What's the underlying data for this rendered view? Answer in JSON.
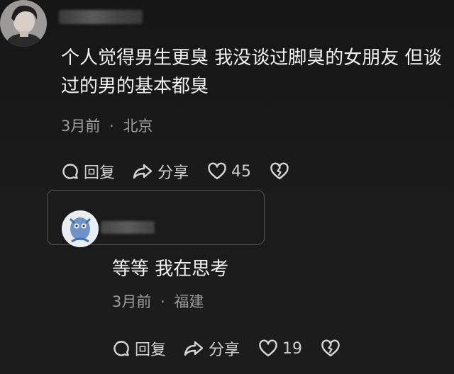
{
  "comment": {
    "text": "个人觉得男生更臭 我没谈过脚臭的女朋友 但谈过的男的基本都臭",
    "time": "3月前",
    "separator": "·",
    "location": "北京",
    "reply_label": "回复",
    "share_label": "分享",
    "like_count": "45"
  },
  "reply": {
    "text": "等等 我在思考",
    "time": "3月前",
    "separator": "·",
    "location": "福建",
    "reply_label": "回复",
    "share_label": "分享",
    "like_count": "19"
  }
}
